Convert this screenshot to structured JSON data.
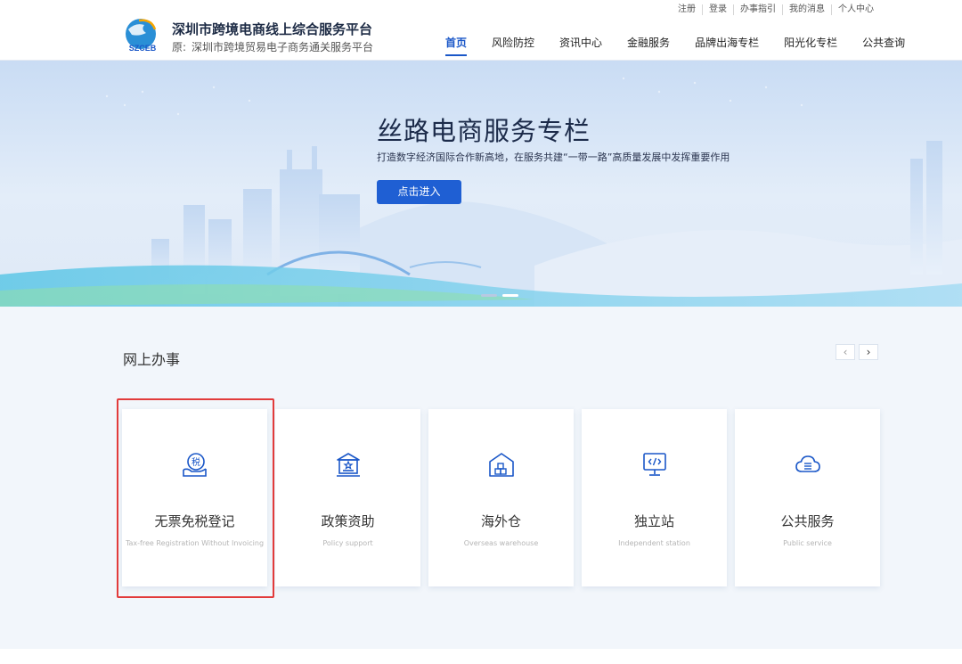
{
  "header": {
    "logo_text": "SZCEB",
    "brand_title": "深圳市跨境电商线上综合服务平台",
    "brand_sub_prefix": "原:",
    "brand_sub": "深圳市跨境贸易电子商务通关服务平台",
    "util_links": [
      "注册",
      "登录",
      "办事指引",
      "我的消息",
      "个人中心"
    ],
    "nav": [
      {
        "label": "首页",
        "active": true
      },
      {
        "label": "风险防控"
      },
      {
        "label": "资讯中心"
      },
      {
        "label": "金融服务"
      },
      {
        "label": "品牌出海专栏"
      },
      {
        "label": "阳光化专栏"
      },
      {
        "label": "公共查询"
      }
    ]
  },
  "banner": {
    "title": "丝路电商服务专栏",
    "subtitle": "打造数字经济国际合作新高地，在服务共建“一带一路”高质量发展中发挥重要作用",
    "button_label": "点击进入"
  },
  "section": {
    "title": "网上办事",
    "prev": "‹",
    "next": "›",
    "cards": [
      {
        "cn": "无票免税登记",
        "en": "Tax-free Registration Without Invoicing",
        "icon": "tax-icon"
      },
      {
        "cn": "政策资助",
        "en": "Policy support",
        "icon": "policy-building-icon"
      },
      {
        "cn": "海外仓",
        "en": "Overseas warehouse",
        "icon": "warehouse-icon"
      },
      {
        "cn": "独立站",
        "en": "Independent station",
        "icon": "monitor-code-icon"
      },
      {
        "cn": "公共服务",
        "en": "Public service",
        "icon": "cloud-service-icon"
      }
    ]
  },
  "colors": {
    "accent": "#1a57c8",
    "button": "#1f5fd3",
    "highlight": "#e23b3b"
  }
}
